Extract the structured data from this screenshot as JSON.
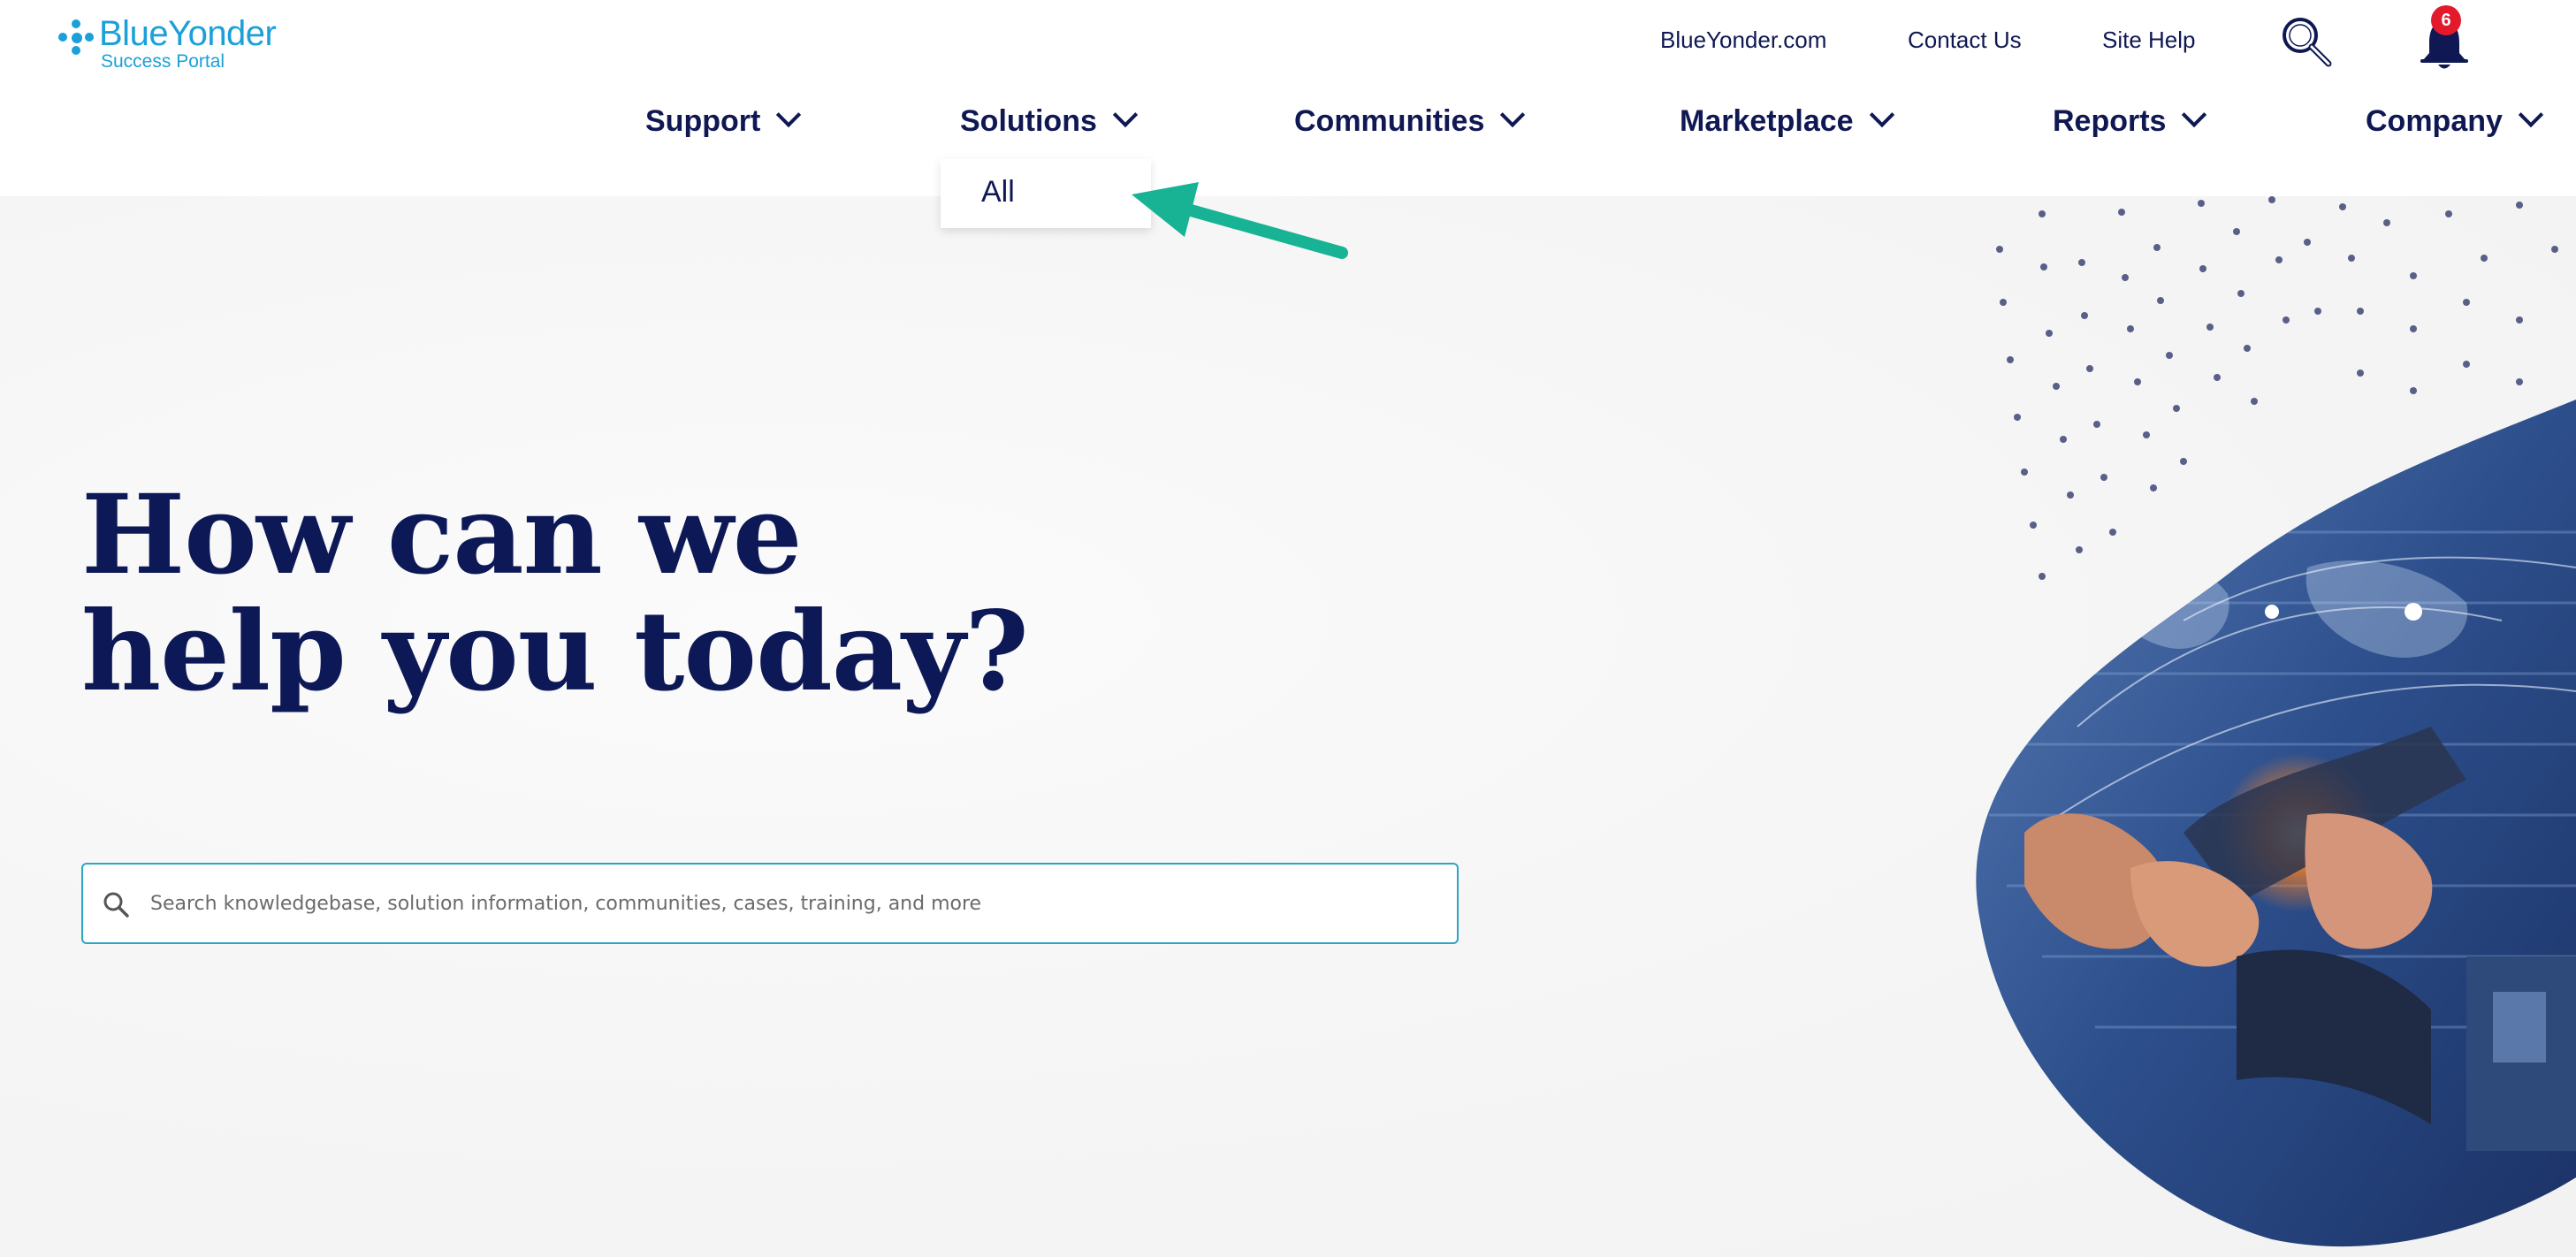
{
  "brand": {
    "name": "BlueYonder",
    "tagline": "Success Portal",
    "accent": "#1ba0d8"
  },
  "utility_nav": {
    "links": [
      "BlueYonder.com",
      "Contact Us",
      "Site Help"
    ],
    "search_icon": "magnifier-icon",
    "notifications": {
      "icon": "bell-icon",
      "count": "6",
      "badge_color": "#e21a2c"
    }
  },
  "main_nav": {
    "items": [
      {
        "label": "Support"
      },
      {
        "label": "Solutions"
      },
      {
        "label": "Communities"
      },
      {
        "label": "Marketplace"
      },
      {
        "label": "Reports"
      },
      {
        "label": "Company"
      }
    ],
    "open_dropdown": {
      "parent": "Solutions",
      "items": [
        "All"
      ]
    }
  },
  "annotation": {
    "color": "#17b394"
  },
  "hero": {
    "title_line1": "How can we",
    "title_line2": "help you today?",
    "search_placeholder": "Search knowledgebase, solution information, communities, cases, training, and more"
  },
  "colors": {
    "navy": "#0f1852",
    "border": "#2aa6c5"
  }
}
